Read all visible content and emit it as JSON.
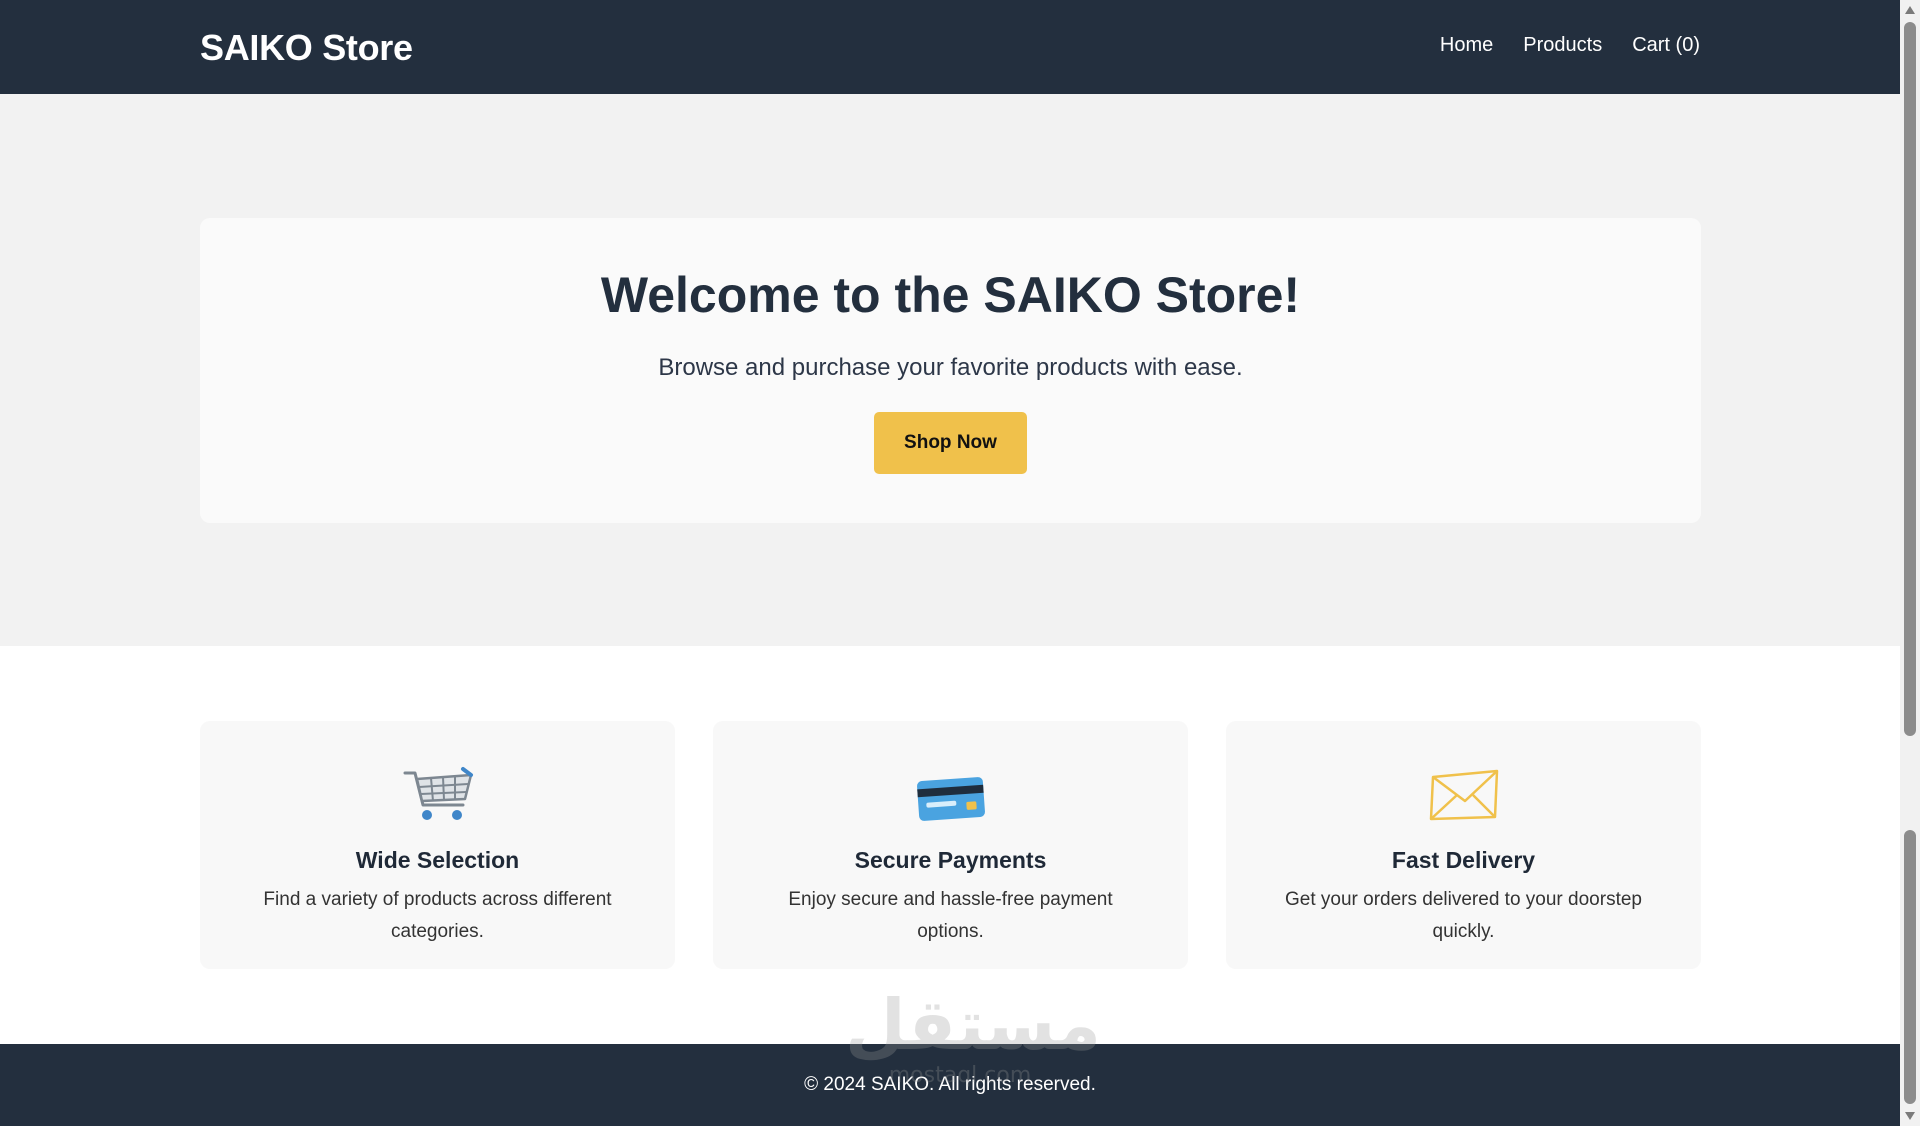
{
  "header": {
    "brand": "SAIKO Store",
    "nav": [
      {
        "label": "Home"
      },
      {
        "label": "Products"
      },
      {
        "label": "Cart (0)"
      }
    ]
  },
  "hero": {
    "title": "Welcome to the SAIKO Store!",
    "subtitle": "Browse and purchase your favorite products with ease.",
    "cta_label": "Shop Now"
  },
  "features": [
    {
      "icon": "shopping-cart-icon",
      "title": "Wide Selection",
      "description": "Find a variety of products across different categories."
    },
    {
      "icon": "credit-card-icon",
      "title": "Secure Payments",
      "description": "Enjoy secure and hassle-free payment options."
    },
    {
      "icon": "envelope-icon",
      "title": "Fast Delivery",
      "description": "Get your orders delivered to your doorstep quickly."
    }
  ],
  "footer": {
    "copyright": "© 2024 SAIKO. All rights reserved."
  },
  "watermark": {
    "arabic": "مستقل",
    "latin": "mostaql.com"
  },
  "colors": {
    "header_bg": "#232f3e",
    "hero_bg": "#f2f2f2",
    "accent": "#f0c14b",
    "card_bg": "#fafafa"
  }
}
